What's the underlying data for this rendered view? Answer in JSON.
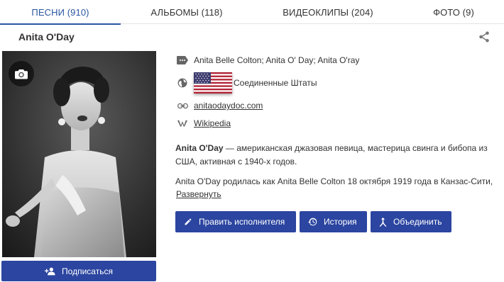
{
  "tabs": [
    {
      "label": "ПЕСНИ (910)",
      "active": true
    },
    {
      "label": "АЛЬБОМЫ (118)",
      "active": false
    },
    {
      "label": "ВИДЕОКЛИПЫ (204)",
      "active": false
    },
    {
      "label": "ФОТО (9)",
      "active": false
    }
  ],
  "artist": {
    "name": "Anita O'Day",
    "aka": "Anita Belle Colton; Anita O' Day; Anita O'ray",
    "country": "Соединенные Штаты",
    "website": "anitaodaydoc.com",
    "wiki": "Wikipedia",
    "bio_name": "Anita O'Day",
    "bio_rest": " — американская джазовая певица, мастерица свинга и бибопа из США, активная с 1940-х годов.",
    "bio_more": "Anita O'Day родилась как Anita Belle Colton 18 октября 1919 года в Канзас-Сити,",
    "expand_label": "Развернуть"
  },
  "buttons": {
    "subscribe": "Подписаться",
    "edit": "Править исполнителя",
    "history": "История",
    "merge": "Объединить"
  },
  "colors": {
    "accent": "#2a56a3",
    "button": "#2b45a0"
  },
  "icons": {
    "aka": "label-icon",
    "country": "globe-icon",
    "website": "link-icon",
    "wiki": "wikipedia-icon",
    "share": "share-icon",
    "camera": "camera-icon"
  }
}
